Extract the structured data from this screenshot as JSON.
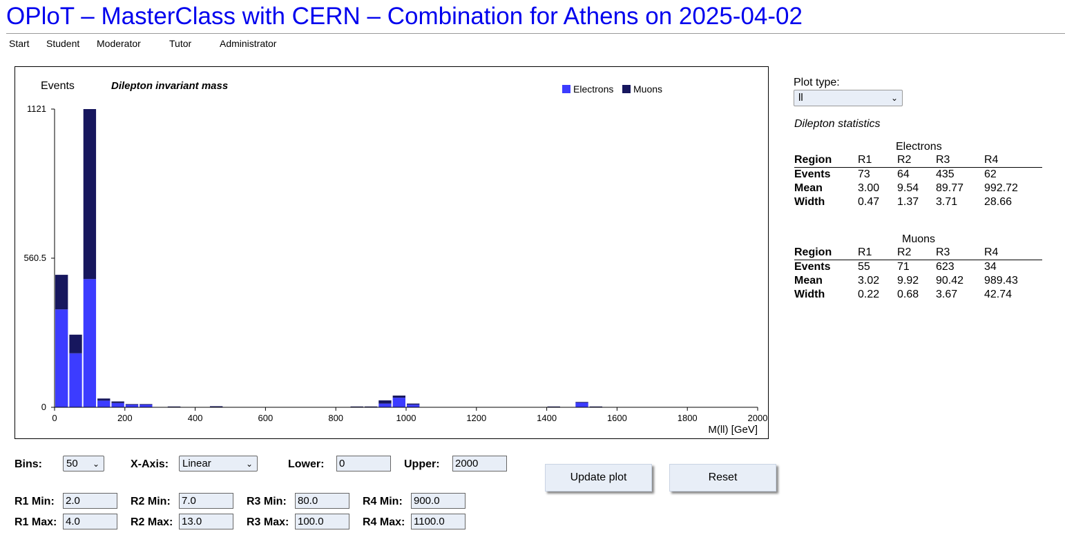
{
  "page": {
    "title": "OPloT – MasterClass with CERN – Combination for Athens on 2025-04-02"
  },
  "nav": [
    "Start",
    "Student",
    "Moderator",
    "Tutor",
    "Administrator"
  ],
  "colors": {
    "electrons": "#3c3cff",
    "muons": "#17175e",
    "title": "#0000ee"
  },
  "chart_data": {
    "type": "bar",
    "stacked": true,
    "title": "Dilepton invariant mass",
    "ylabel": "Events",
    "xlabel": "M(ll) [GeV]",
    "xlim": [
      0,
      2000
    ],
    "ylim": [
      0,
      1121
    ],
    "bin_width": 40,
    "x_ticks": [
      0,
      200,
      400,
      600,
      800,
      1000,
      1200,
      1400,
      1600,
      1800,
      2000
    ],
    "y_ticks": [
      0,
      560.5,
      1121
    ],
    "y_tick_labels": [
      "0",
      "560.5",
      "1121"
    ],
    "legend": {
      "position": "top-right"
    },
    "x": [
      0,
      40,
      80,
      120,
      160,
      200,
      240,
      280,
      320,
      360,
      400,
      440,
      480,
      520,
      560,
      600,
      640,
      680,
      720,
      760,
      800,
      840,
      880,
      920,
      960,
      1000,
      1040,
      1080,
      1120,
      1160,
      1200,
      1240,
      1280,
      1320,
      1360,
      1400,
      1440,
      1480,
      1520,
      1560,
      1600,
      1640,
      1680,
      1720,
      1760,
      1800,
      1840,
      1880,
      1920,
      1960
    ],
    "series": [
      {
        "name": "Electrons",
        "color": "#3c3cff",
        "values": [
          368,
          203,
          482,
          25,
          16,
          10,
          10,
          0,
          2,
          0,
          0,
          2,
          0,
          0,
          0,
          0,
          0,
          0,
          0,
          0,
          0,
          2,
          2,
          14,
          36,
          10,
          0,
          0,
          0,
          0,
          0,
          0,
          0,
          0,
          0,
          2,
          0,
          18,
          2,
          0,
          0,
          0,
          0,
          0,
          0,
          0,
          0,
          0,
          0,
          0
        ]
      },
      {
        "name": "Muons",
        "color": "#17175e",
        "values": [
          130,
          70,
          639,
          8,
          6,
          2,
          2,
          0,
          1,
          0,
          0,
          2,
          0,
          0,
          0,
          0,
          0,
          0,
          0,
          0,
          0,
          1,
          1,
          12,
          8,
          4,
          0,
          0,
          0,
          0,
          0,
          0,
          0,
          0,
          0,
          1,
          0,
          2,
          1,
          0,
          0,
          0,
          0,
          0,
          0,
          0,
          0,
          0,
          0,
          0
        ]
      }
    ]
  },
  "plot_type": {
    "label": "Plot type:",
    "value": "ll"
  },
  "stats": {
    "heading": "Dilepton statistics",
    "groups": [
      {
        "name": "Electrons",
        "header": [
          "Region",
          "R1",
          "R2",
          "R3",
          "R4"
        ],
        "rows": [
          [
            "Events",
            "73",
            "64",
            "435",
            "62"
          ],
          [
            "Mean",
            "3.00",
            "9.54",
            "89.77",
            "992.72"
          ],
          [
            "Width",
            "0.47",
            "1.37",
            "3.71",
            "28.66"
          ]
        ]
      },
      {
        "name": "Muons",
        "header": [
          "Region",
          "R1",
          "R2",
          "R3",
          "R4"
        ],
        "rows": [
          [
            "Events",
            "55",
            "71",
            "623",
            "34"
          ],
          [
            "Mean",
            "3.02",
            "9.92",
            "90.42",
            "989.43"
          ],
          [
            "Width",
            "0.22",
            "0.68",
            "3.67",
            "42.74"
          ]
        ]
      }
    ]
  },
  "controls": {
    "bins_label": "Bins:",
    "bins_value": "50",
    "xaxis_label": "X-Axis:",
    "xaxis_value": "Linear",
    "lower_label": "Lower:",
    "lower_value": "0",
    "upper_label": "Upper:",
    "upper_value": "2000",
    "update_button": "Update plot",
    "reset_button": "Reset",
    "regions": [
      {
        "min_label": "R1 Min:",
        "min_value": "2.0",
        "max_label": "R1 Max:",
        "max_value": "4.0"
      },
      {
        "min_label": "R2 Min:",
        "min_value": "7.0",
        "max_label": "R2 Max:",
        "max_value": "13.0"
      },
      {
        "min_label": "R3 Min:",
        "min_value": "80.0",
        "max_label": "R3 Max:",
        "max_value": "100.0"
      },
      {
        "min_label": "R4 Min:",
        "min_value": "900.0",
        "max_label": "R4 Max:",
        "max_value": "1100.0"
      }
    ]
  }
}
